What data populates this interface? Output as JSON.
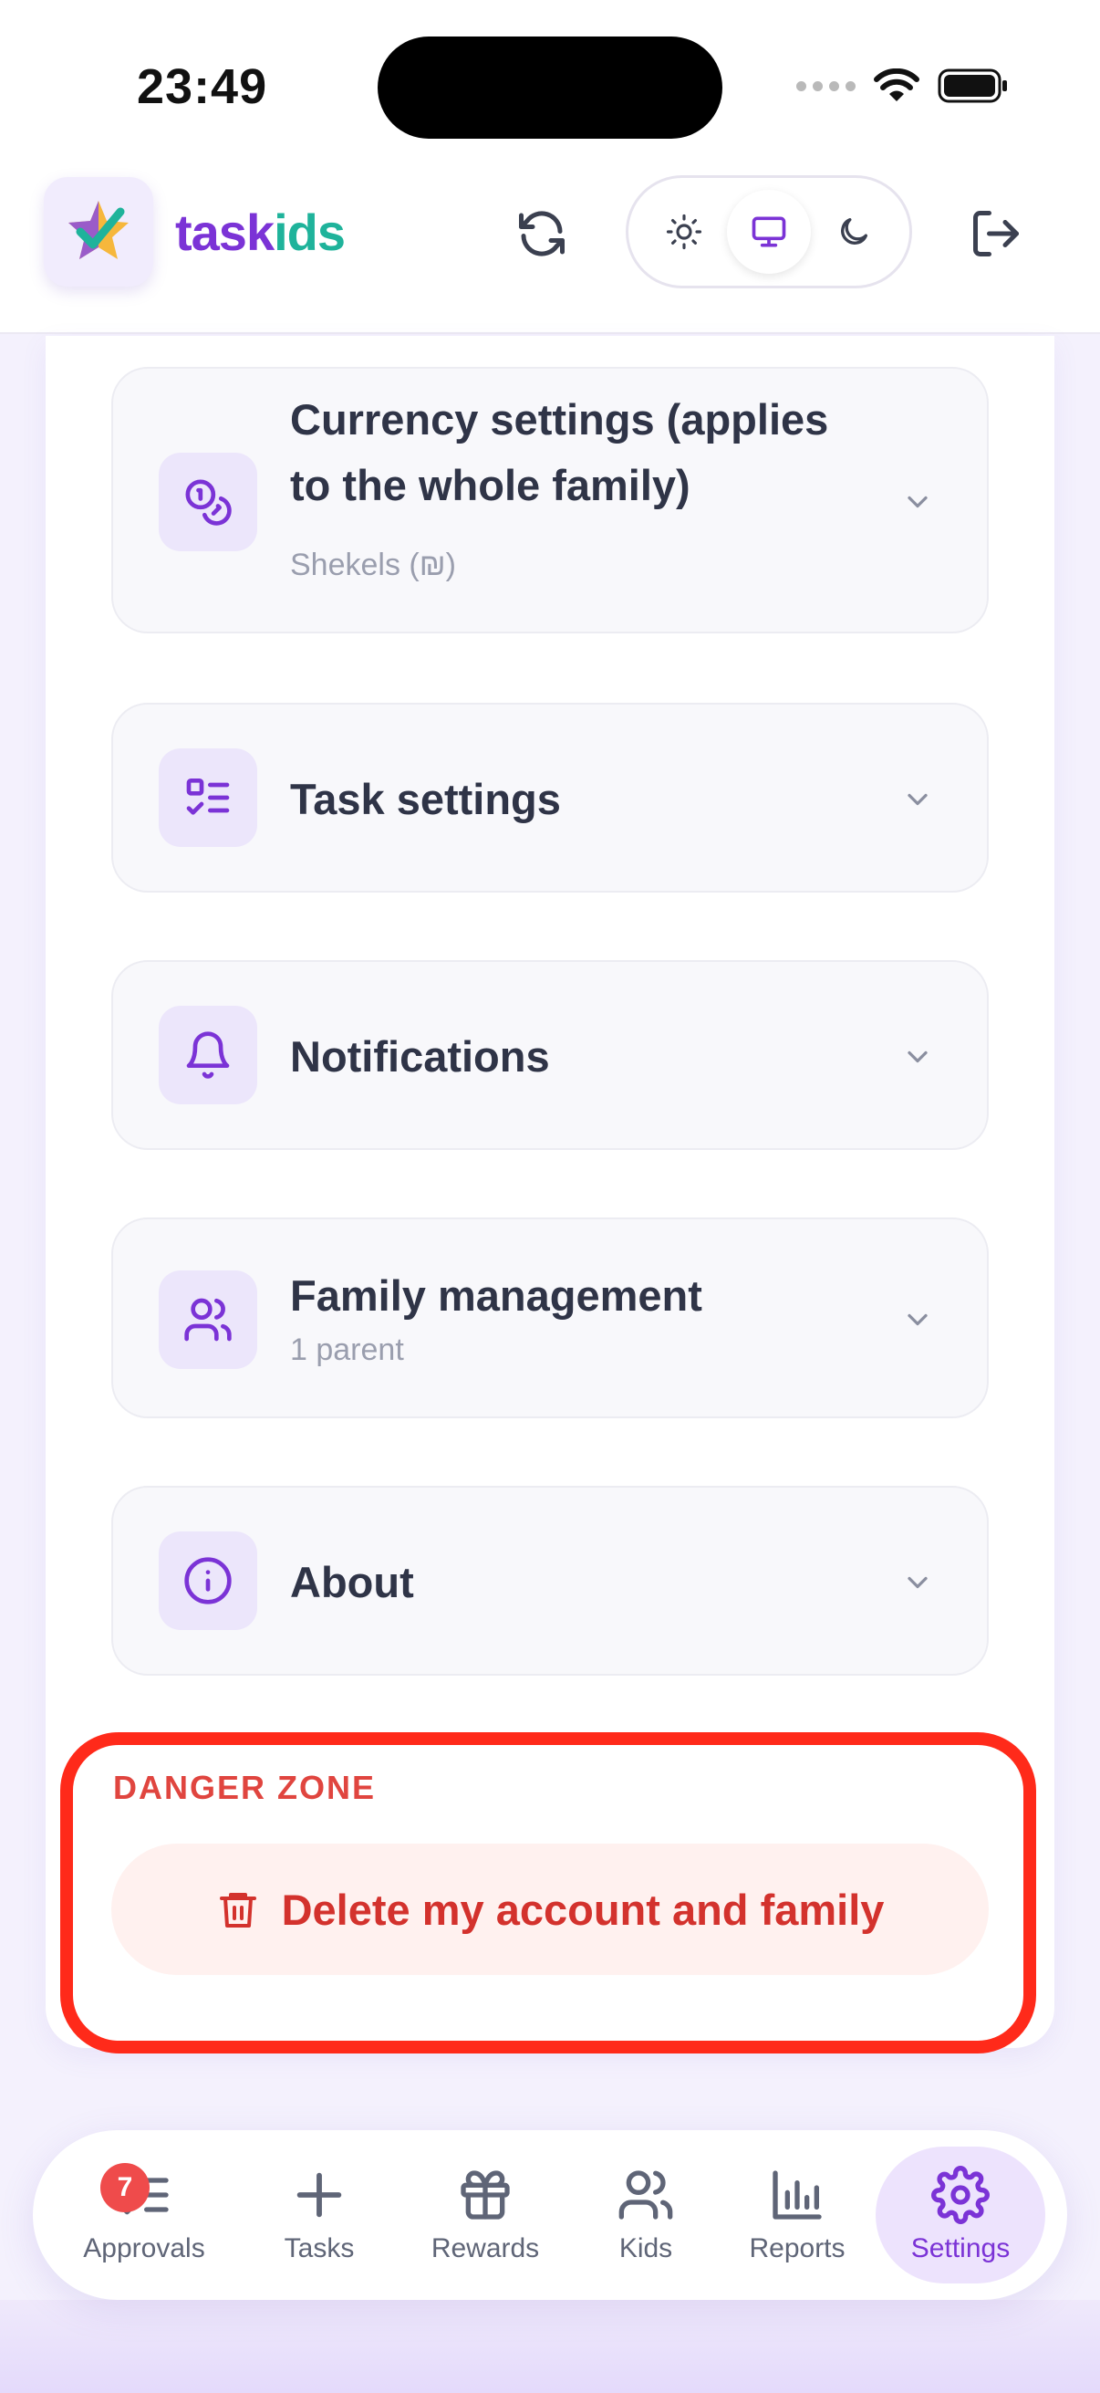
{
  "status_bar": {
    "time": "23:49"
  },
  "header": {
    "brand_part1": "task",
    "brand_part2": "ids",
    "theme_options": [
      "light",
      "system",
      "dark"
    ],
    "theme_selected": "system"
  },
  "settings": [
    {
      "title_line1": "Currency settings (applies",
      "title_line2": "to the whole family)",
      "subtitle": "Shekels (₪)",
      "icon": "currency-icon"
    },
    {
      "title": "Task settings",
      "icon": "task-list-icon"
    },
    {
      "title": "Notifications",
      "icon": "bell-icon"
    },
    {
      "title": "Family management",
      "subtitle": "1 parent",
      "icon": "users-icon"
    },
    {
      "title": "About",
      "icon": "info-icon"
    }
  ],
  "danger_zone": {
    "label": "DANGER ZONE",
    "delete_label": "Delete my account and family"
  },
  "bottom_nav": [
    {
      "label": "Approvals",
      "badge": "7",
      "icon": "approvals-icon"
    },
    {
      "label": "Tasks",
      "icon": "plus-icon"
    },
    {
      "label": "Rewards",
      "icon": "gift-icon"
    },
    {
      "label": "Kids",
      "icon": "users-icon"
    },
    {
      "label": "Reports",
      "icon": "bar-chart-icon"
    },
    {
      "label": "Settings",
      "icon": "gear-icon",
      "active": true
    }
  ],
  "colors": {
    "accent": "#7b33d6",
    "brand_teal": "#1fb39b",
    "danger": "#d3322d",
    "highlight": "#ff2a1a"
  }
}
